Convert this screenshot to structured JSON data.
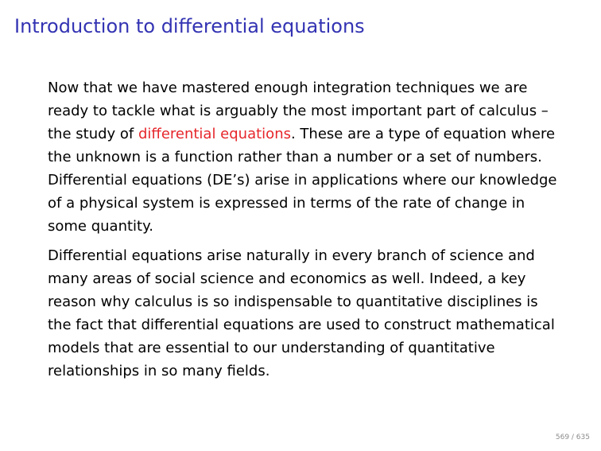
{
  "slide": {
    "title": "Introduction to differential equations",
    "paragraphs": [
      {
        "before": "Now that we have mastered enough integration techniques we are ready to tackle what is arguably the most important part of calculus – the study of ",
        "highlight": "differential equations",
        "after": ".  These are a type of equation where the unknown is a function rather than a number or a set of numbers.  Differential equations (DE’s) arise in applications where our knowledge of a physical system is expressed in terms of the rate of change in some quantity."
      },
      {
        "text": "Differential equations arise naturally in every branch of science and many areas of social science and economics as well.  Indeed, a key reason why calculus is so indispensable to quantitative disciplines is the fact that differential equations are used to construct mathematical models that are essential to our understanding of quantitative relationships in so many fields."
      }
    ],
    "page_number": "569 / 635"
  },
  "colors": {
    "title": "#3333b3",
    "highlight": "#e6262b",
    "text": "#000000"
  }
}
